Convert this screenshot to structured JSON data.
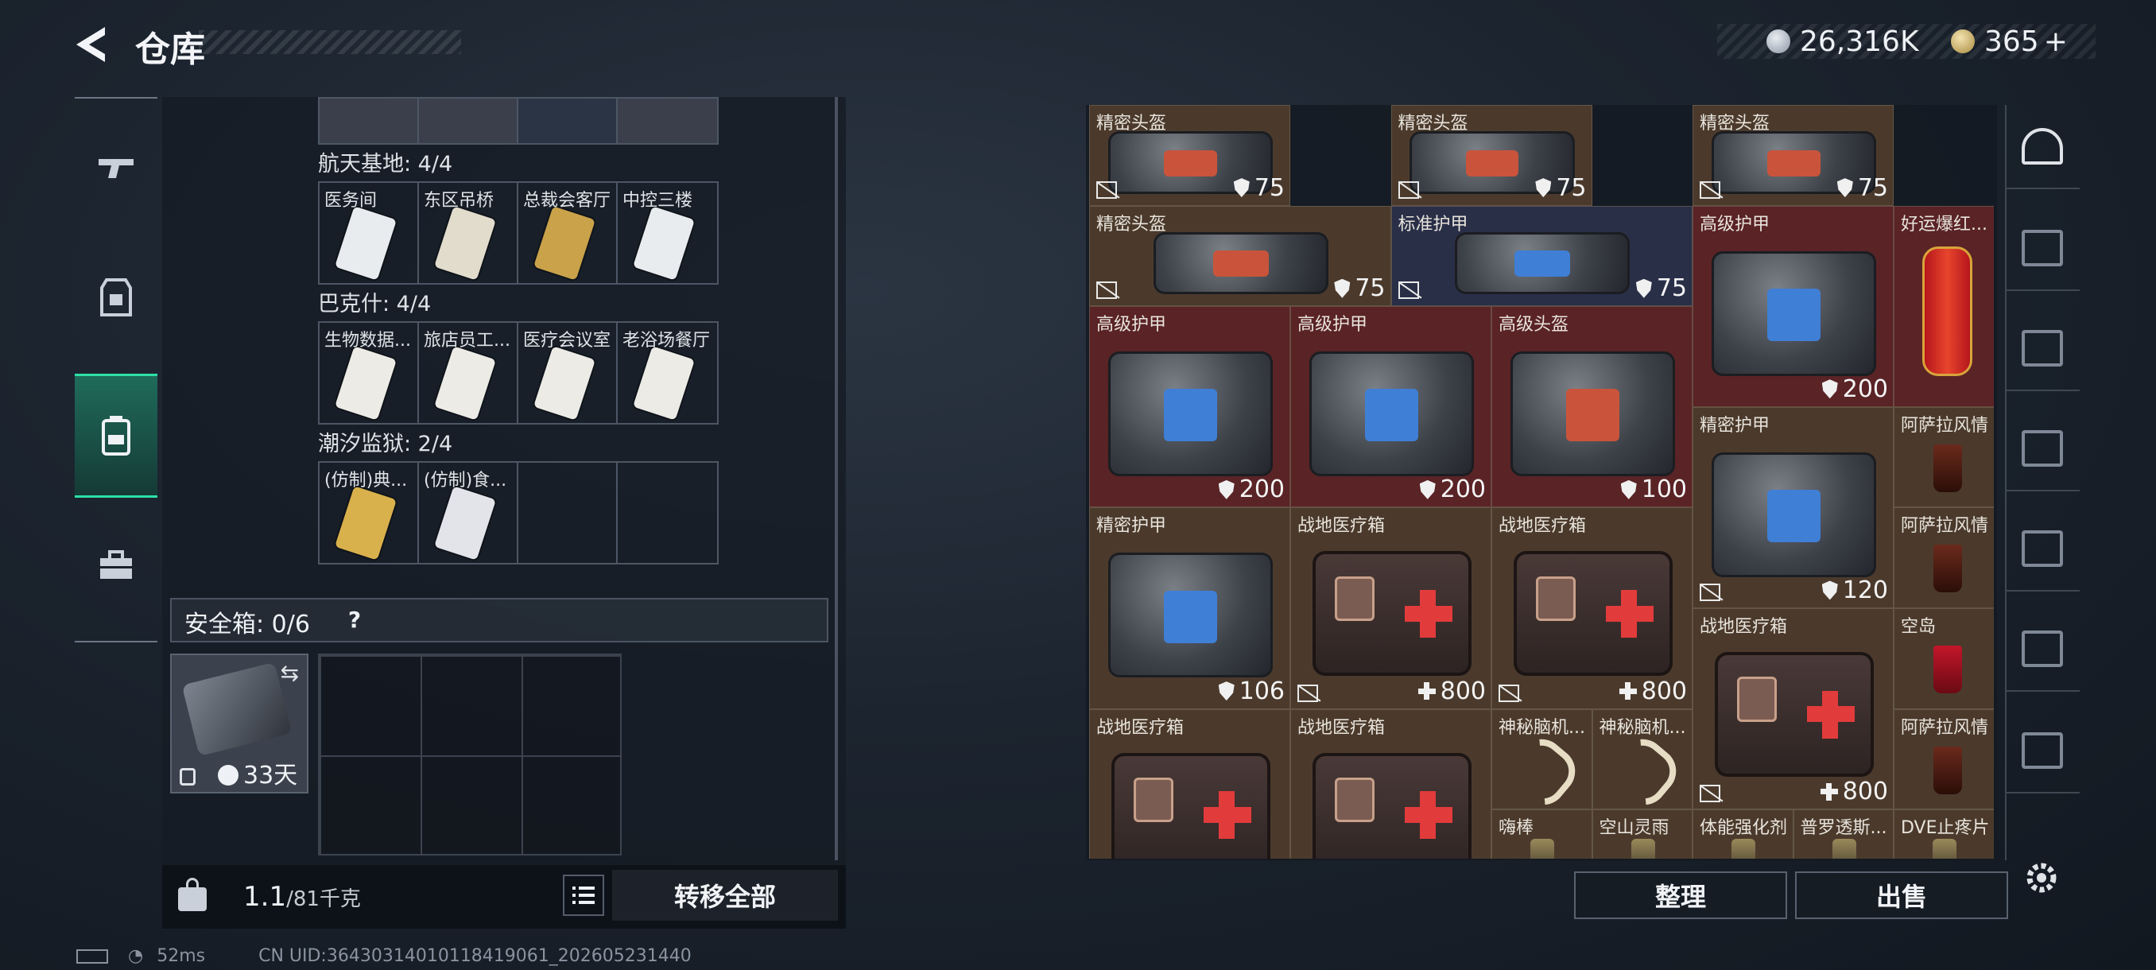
{
  "header": {
    "title": "仓库"
  },
  "currency": {
    "coins": "26,316K",
    "tickets": "365",
    "ticket_plus": "+"
  },
  "left_tabs": [
    "weapons-tab",
    "armor-tab",
    "backpack-tab",
    "toolbox-tab"
  ],
  "keycard_sections": [
    {
      "title": "航天基地: 4/4",
      "cards": [
        {
          "label": "医务间",
          "color": "#3b3f4c"
        },
        {
          "label": "东区吊桥",
          "color": "#4a3f30"
        },
        {
          "label": "总裁会客厅",
          "color": "#6a2a2a"
        },
        {
          "label": "中控三楼",
          "color": "#3b3f4c"
        }
      ]
    },
    {
      "title": "巴克什: 4/4",
      "cards": [
        {
          "label": "生物数据...",
          "color": "#4a3f30"
        },
        {
          "label": "旅店员工...",
          "color": "#4a3f30"
        },
        {
          "label": "医疗会议室",
          "color": "#4a3f30"
        },
        {
          "label": "老浴场餐厅",
          "color": "#4a3f30"
        }
      ]
    },
    {
      "title": "潮汐监狱: 2/4",
      "cards": [
        {
          "label": "(仿制)典...",
          "color": "#6a2a2a"
        },
        {
          "label": "(仿制)食...",
          "color": "#3b3f4c"
        },
        {
          "label": "",
          "color": "#1b2129"
        },
        {
          "label": "",
          "color": "#1b2129"
        }
      ]
    }
  ],
  "safe_box": {
    "label": "安全箱: 0/6",
    "help": "?",
    "days": "33天"
  },
  "weight": {
    "current": "1.1",
    "max": "/81千克"
  },
  "buttons": {
    "transfer_all": "转移全部",
    "sort": "整理",
    "sell": "出售"
  },
  "status": {
    "ping": "52ms",
    "uid": "CN UID:3643031401011841906​1_202605231440"
  },
  "inventory": [
    {
      "name": "精密头盔",
      "stat": "75",
      "stat_type": "shield",
      "no_stack": true,
      "kind": "helmet",
      "bg": "#4b3a2c",
      "col": 0,
      "row": 0,
      "w": 2,
      "h": 1
    },
    {
      "name": "精密头盔",
      "stat": "75",
      "stat_type": "shield",
      "no_stack": true,
      "kind": "helmet",
      "bg": "#4b3a2c",
      "col": 3,
      "row": 0,
      "w": 2,
      "h": 1
    },
    {
      "name": "精密头盔",
      "stat": "75",
      "stat_type": "shield",
      "no_stack": true,
      "kind": "helmet",
      "bg": "#4b3a2c",
      "col": 6,
      "row": 0,
      "w": 2,
      "h": 1
    },
    {
      "name": "精密头盔",
      "stat": "75",
      "stat_type": "shield",
      "no_stack": true,
      "kind": "helmet",
      "bg": "#4b3a2c",
      "col": 0,
      "row": 1,
      "w": 3,
      "h": 1
    },
    {
      "name": "标准护甲",
      "stat": "75",
      "stat_type": "shield",
      "no_stack": true,
      "kind": "armor",
      "bg": "#2a2f48",
      "col": 3,
      "row": 1,
      "w": 3,
      "h": 1
    },
    {
      "name": "高级护甲",
      "stat": "200",
      "stat_type": "shield",
      "no_stack": false,
      "kind": "armor",
      "bg": "#5a2326",
      "col": 6,
      "row": 1,
      "w": 2,
      "h": 2
    },
    {
      "name": "好运爆红...",
      "stat": "",
      "stat_type": "",
      "no_stack": false,
      "kind": "firecracker",
      "bg": "#5a2326",
      "col": 8,
      "row": 1,
      "w": 1,
      "h": 2
    },
    {
      "name": "高级护甲",
      "stat": "200",
      "stat_type": "shield",
      "no_stack": false,
      "kind": "armor",
      "bg": "#5a2326",
      "col": 0,
      "row": 2,
      "w": 2,
      "h": 2
    },
    {
      "name": "高级护甲",
      "stat": "200",
      "stat_type": "shield",
      "no_stack": false,
      "kind": "armor",
      "bg": "#5a2326",
      "col": 2,
      "row": 2,
      "w": 2,
      "h": 2
    },
    {
      "name": "高级头盔",
      "stat": "100",
      "stat_type": "shield",
      "no_stack": false,
      "kind": "helmet",
      "bg": "#5a2326",
      "col": 4,
      "row": 2,
      "w": 2,
      "h": 2
    },
    {
      "name": "精密护甲",
      "stat": "120",
      "stat_type": "shield",
      "no_stack": true,
      "kind": "armor",
      "bg": "#4b3a2c",
      "col": 6,
      "row": 3,
      "w": 2,
      "h": 2
    },
    {
      "name": "阿萨拉风情",
      "stat": "",
      "stat_type": "",
      "no_stack": false,
      "kind": "drink",
      "bg": "#4b3a2c",
      "col": 8,
      "row": 3,
      "w": 1,
      "h": 1
    },
    {
      "name": "精密护甲",
      "stat": "106",
      "stat_type": "shield",
      "no_stack": false,
      "kind": "armor",
      "bg": "#4b3a2c",
      "col": 0,
      "row": 4,
      "w": 2,
      "h": 2
    },
    {
      "name": "战地医疗箱",
      "stat": "800",
      "stat_type": "plus",
      "no_stack": true,
      "kind": "medkit",
      "bg": "#4b3a2c",
      "col": 2,
      "row": 4,
      "w": 2,
      "h": 2
    },
    {
      "name": "战地医疗箱",
      "stat": "800",
      "stat_type": "plus",
      "no_stack": true,
      "kind": "medkit",
      "bg": "#4b3a2c",
      "col": 4,
      "row": 4,
      "w": 2,
      "h": 2
    },
    {
      "name": "阿萨拉风情",
      "stat": "",
      "stat_type": "",
      "no_stack": false,
      "kind": "drink",
      "bg": "#4b3a2c",
      "col": 8,
      "row": 4,
      "w": 1,
      "h": 1
    },
    {
      "name": "战地医疗箱",
      "stat": "800",
      "stat_type": "plus",
      "no_stack": true,
      "kind": "medkit",
      "bg": "#4b3a2c",
      "col": 6,
      "row": 5,
      "w": 2,
      "h": 2
    },
    {
      "name": "空岛",
      "stat": "",
      "stat_type": "",
      "no_stack": false,
      "kind": "drink-red",
      "bg": "#4b3a2c",
      "col": 8,
      "row": 5,
      "w": 1,
      "h": 1
    },
    {
      "name": "战地医疗箱",
      "stat": "",
      "stat_type": "",
      "no_stack": false,
      "kind": "medkit",
      "bg": "#4b3a2c",
      "col": 0,
      "row": 6,
      "w": 2,
      "h": 2
    },
    {
      "name": "战地医疗箱",
      "stat": "",
      "stat_type": "",
      "no_stack": false,
      "kind": "medkit",
      "bg": "#4b3a2c",
      "col": 2,
      "row": 6,
      "w": 2,
      "h": 2
    },
    {
      "name": "神秘脑机...",
      "stat": "",
      "stat_type": "",
      "no_stack": false,
      "kind": "cable",
      "bg": "#4b3a2c",
      "col": 4,
      "row": 6,
      "w": 1,
      "h": 1
    },
    {
      "name": "神秘脑机...",
      "stat": "",
      "stat_type": "",
      "no_stack": false,
      "kind": "cable",
      "bg": "#4b3a2c",
      "col": 5,
      "row": 6,
      "w": 1,
      "h": 1
    },
    {
      "name": "阿萨拉风情",
      "stat": "",
      "stat_type": "",
      "no_stack": false,
      "kind": "drink",
      "bg": "#4b3a2c",
      "col": 8,
      "row": 6,
      "w": 1,
      "h": 1
    },
    {
      "name": "嗨棒",
      "stat": "",
      "stat_type": "",
      "no_stack": false,
      "kind": "small",
      "bg": "#4b3a2c",
      "col": 4,
      "row": 7,
      "w": 1,
      "h": 1
    },
    {
      "name": "空山灵雨",
      "stat": "",
      "stat_type": "",
      "no_stack": false,
      "kind": "small",
      "bg": "#4b3a2c",
      "col": 5,
      "row": 7,
      "w": 1,
      "h": 1
    },
    {
      "name": "体能强化剂",
      "stat": "",
      "stat_type": "",
      "no_stack": false,
      "kind": "small",
      "bg": "#4b3a2c",
      "col": 6,
      "row": 7,
      "w": 1,
      "h": 1
    },
    {
      "name": "普罗透斯...",
      "stat": "",
      "stat_type": "",
      "no_stack": false,
      "kind": "small",
      "bg": "#4b3a2c",
      "col": 7,
      "row": 7,
      "w": 1,
      "h": 1
    },
    {
      "name": "DVE止疼片",
      "stat": "",
      "stat_type": "",
      "no_stack": false,
      "kind": "small",
      "bg": "#4b3a2c",
      "col": 8,
      "row": 7,
      "w": 1,
      "h": 1
    }
  ],
  "side_nav": [
    "helmet-slot-icon",
    "armor-tier3-icon",
    "medkit-tier4-icon",
    "armor-tier3-icon",
    "armor-tier3-icon",
    "backpack-tier4-icon",
    "rig-tier3-icon"
  ]
}
